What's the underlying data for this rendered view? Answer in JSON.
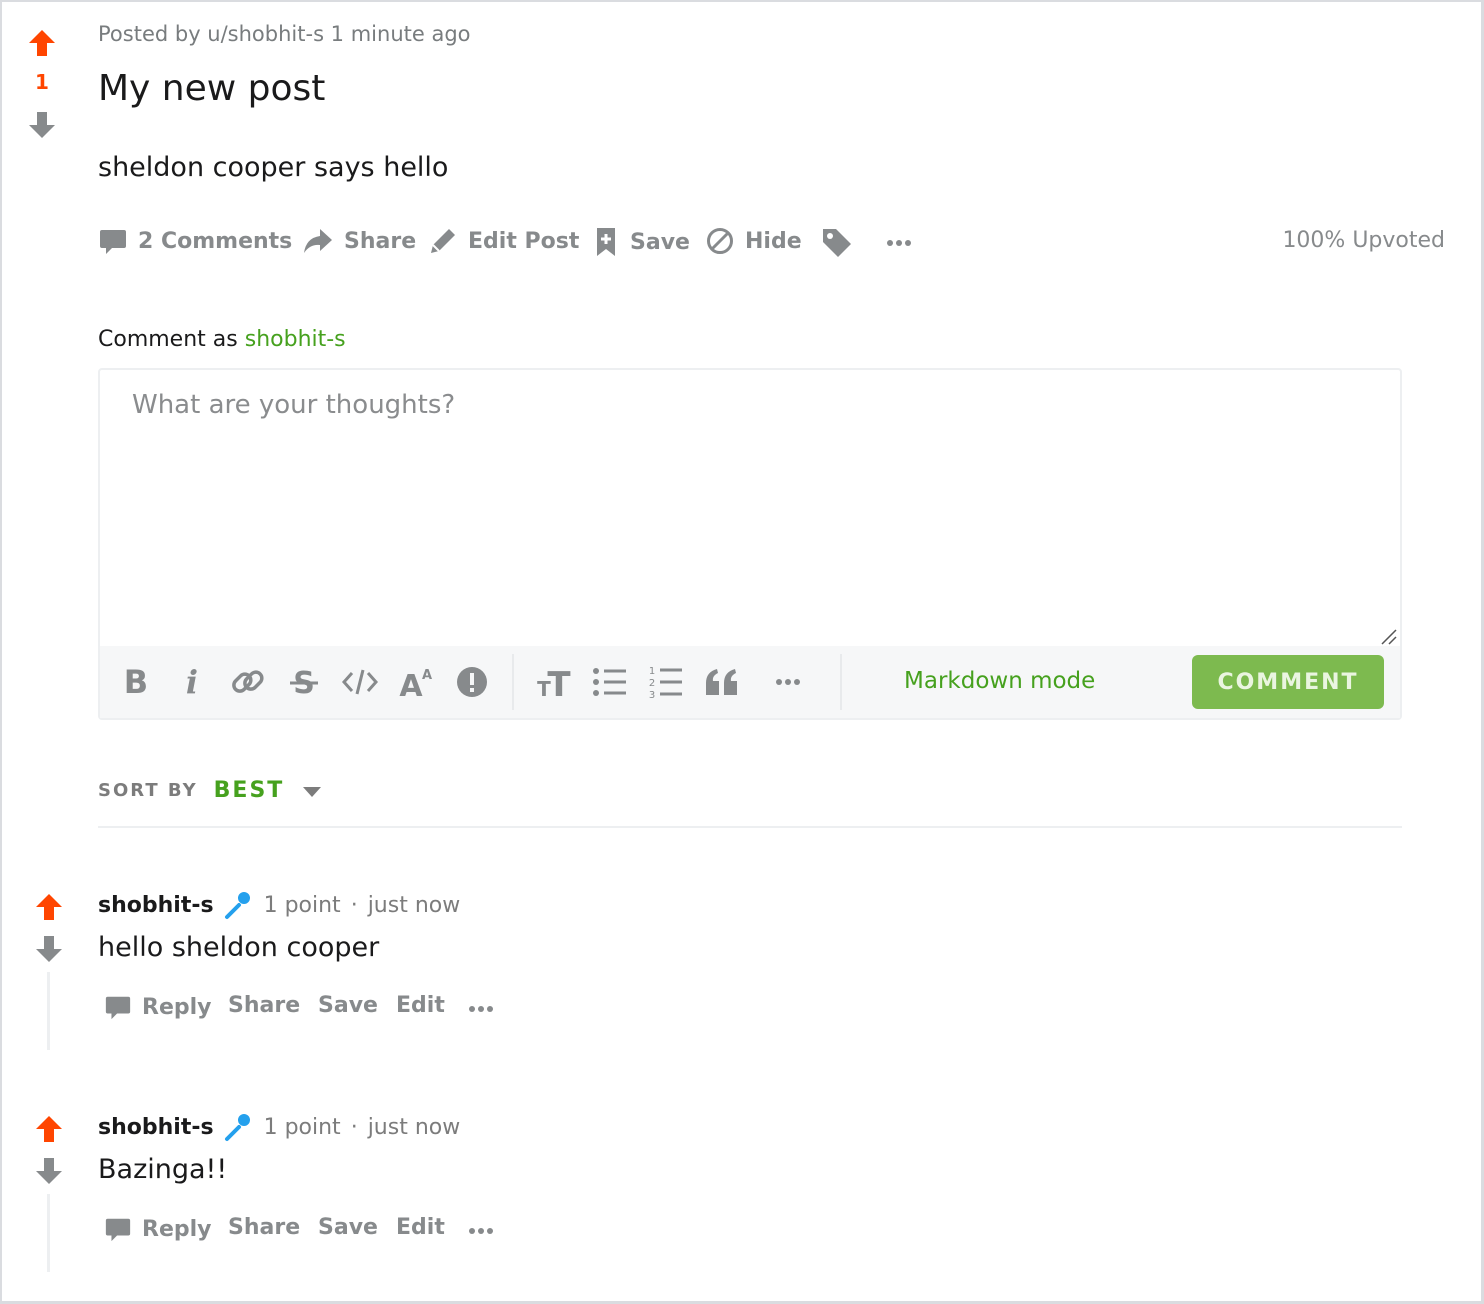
{
  "post": {
    "score": "1",
    "meta": "Posted by u/shobhit-s 1 minute ago",
    "title": "My new post",
    "body": "sheldon cooper says hello",
    "actions": {
      "comments": "2 Comments",
      "share": "Share",
      "edit": "Edit Post",
      "save": "Save",
      "hide": "Hide"
    },
    "upvoted": "100% Upvoted"
  },
  "composer": {
    "comment_as_prefix": "Comment as",
    "username": "shobhit-s",
    "placeholder": "What are your thoughts?",
    "markdown_mode": "Markdown mode",
    "submit": "COMMENT",
    "toolbar_icons": [
      "bold-icon",
      "italic-icon",
      "link-icon",
      "strikethrough-icon",
      "inline-code-icon",
      "superscript-icon",
      "spoiler-icon",
      "heading-icon",
      "bulleted-list-icon",
      "numbered-list-icon",
      "quote-block-icon",
      "more-icon"
    ]
  },
  "sort": {
    "label": "SORT BY",
    "value": "BEST"
  },
  "comments": [
    {
      "author": "shobhit-s",
      "points": "1 point",
      "separator": "·",
      "time": "just now",
      "body": "hello sheldon cooper",
      "actions": {
        "reply": "Reply",
        "share": "Share",
        "save": "Save",
        "edit": "Edit"
      }
    },
    {
      "author": "shobhit-s",
      "points": "1 point",
      "separator": "·",
      "time": "just now",
      "body": "Bazinga!!",
      "actions": {
        "reply": "Reply",
        "share": "Share",
        "save": "Save",
        "edit": "Edit"
      }
    }
  ],
  "colors": {
    "upvote": "#ff4500",
    "accent_green": "#46a11e",
    "comment_button": "#7dba4f",
    "icon_gray": "#878a8c",
    "flair_blue": "#24a0ed"
  }
}
